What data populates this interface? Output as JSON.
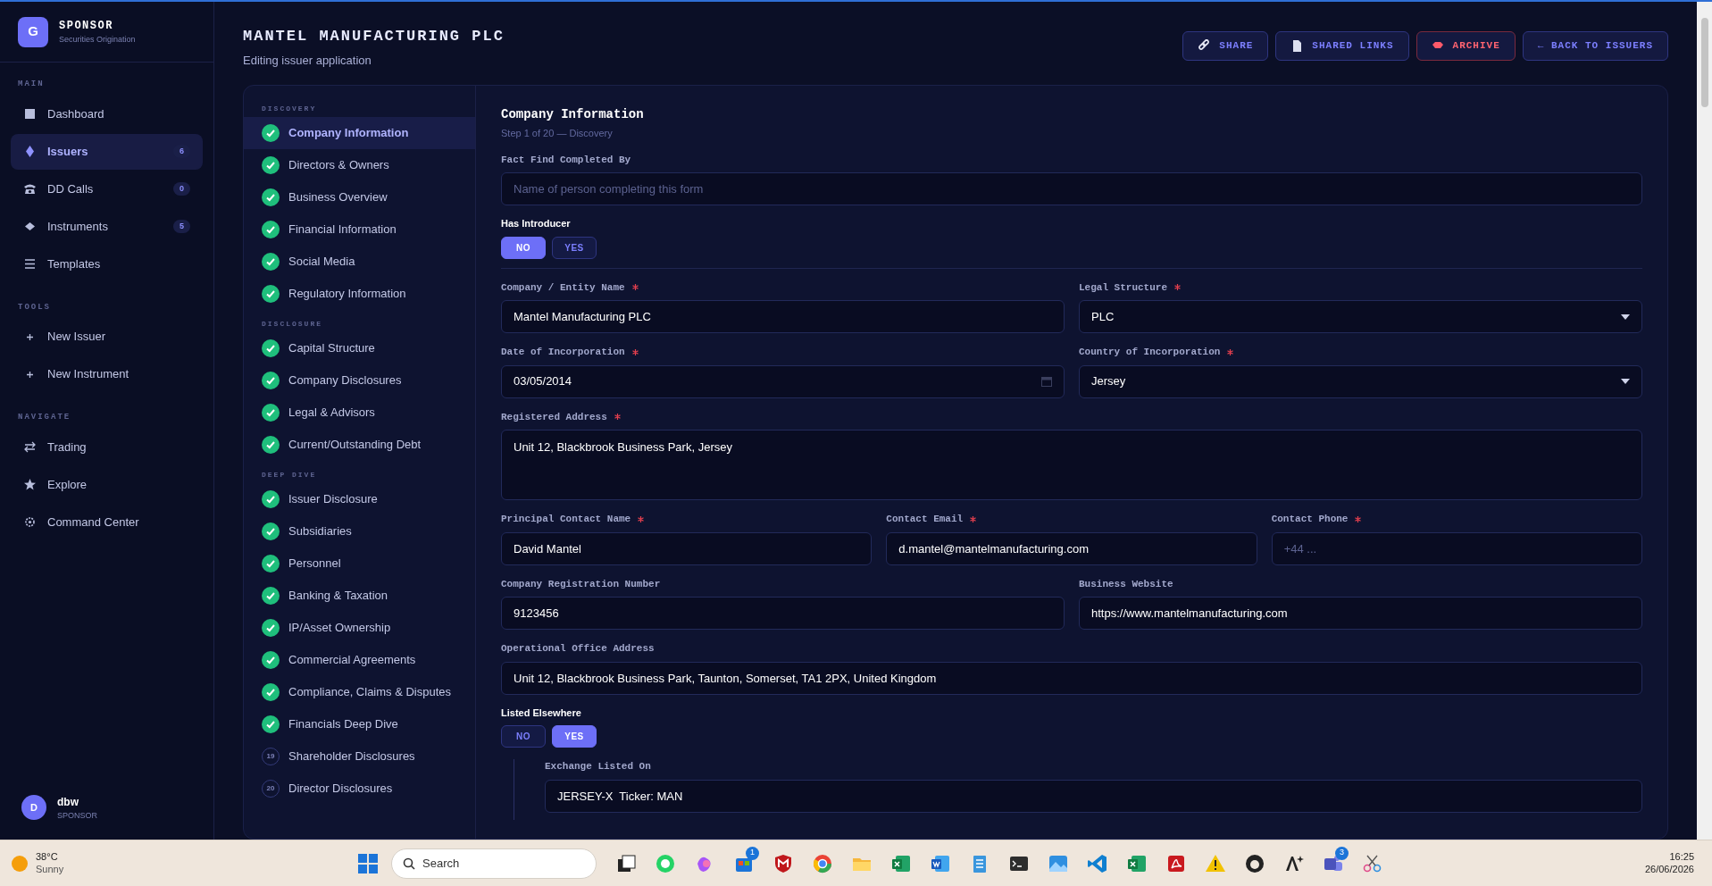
{
  "brand": {
    "logo_letter": "G",
    "title": "SPONSOR",
    "subtitle": "Securities Origination"
  },
  "sidebar": {
    "sections": [
      {
        "title": "MAIN",
        "items": [
          {
            "label": "Dashboard",
            "selected": false
          },
          {
            "label": "Issuers",
            "count": "6",
            "selected": true
          },
          {
            "label": "DD Calls",
            "count": "0",
            "selected": false
          },
          {
            "label": "Instruments",
            "count": "5",
            "selected": false
          },
          {
            "label": "Templates",
            "selected": false
          }
        ]
      },
      {
        "title": "TOOLS",
        "items": [
          {
            "label": "New Issuer",
            "selected": false
          },
          {
            "label": "New Instrument",
            "selected": false
          }
        ]
      },
      {
        "title": "NAVIGATE",
        "items": [
          {
            "label": "Trading",
            "selected": false
          },
          {
            "label": "Explore",
            "selected": false
          },
          {
            "label": "Command Center",
            "selected": false
          }
        ]
      }
    ]
  },
  "user": {
    "initial": "D",
    "name": "dbw",
    "role": "SPONSOR"
  },
  "header": {
    "title": "MANTEL MANUFACTURING PLC",
    "subtitle": "Editing issuer application"
  },
  "actions": [
    {
      "label": "SHARE",
      "kind": "link"
    },
    {
      "label": "SHARED LINKS",
      "kind": "doc"
    },
    {
      "label": "ARCHIVE",
      "kind": "danger"
    },
    {
      "label": "← BACK TO ISSUERS",
      "kind": "plain"
    }
  ],
  "steps": [
    {
      "group": "DISCOVERY",
      "items": [
        {
          "label": "Company Information",
          "done": true,
          "selected": true
        },
        {
          "label": "Directors & Owners",
          "done": true,
          "selected": false
        },
        {
          "label": "Business Overview",
          "done": true,
          "selected": false
        },
        {
          "label": "Financial Information",
          "done": true,
          "selected": false
        },
        {
          "label": "Social Media",
          "done": true,
          "selected": false
        },
        {
          "label": "Regulatory Information",
          "done": true,
          "selected": false
        }
      ]
    },
    {
      "group": "DISCLOSURE",
      "items": [
        {
          "label": "Capital Structure",
          "done": true,
          "selected": false
        },
        {
          "label": "Company Disclosures",
          "done": true,
          "selected": false
        },
        {
          "label": "Legal & Advisors",
          "done": true,
          "selected": false
        },
        {
          "label": "Current/Outstanding Debt",
          "done": true,
          "selected": false
        }
      ]
    },
    {
      "group": "DEEP DIVE",
      "items": [
        {
          "label": "Issuer Disclosure",
          "done": true,
          "selected": false
        },
        {
          "label": "Subsidiaries",
          "done": true,
          "selected": false
        },
        {
          "label": "Personnel",
          "done": true,
          "selected": false
        },
        {
          "label": "Banking & Taxation",
          "done": true,
          "selected": false
        },
        {
          "label": "IP/Asset Ownership",
          "done": true,
          "selected": false
        },
        {
          "label": "Commercial Agreements",
          "done": true,
          "selected": false
        },
        {
          "label": "Compliance, Claims & Disputes",
          "done": true,
          "selected": false
        },
        {
          "label": "Financials Deep Dive",
          "done": true,
          "selected": false
        },
        {
          "label": "Shareholder Disclosures",
          "done": false,
          "number": "19",
          "selected": false
        },
        {
          "label": "Director Disclosures",
          "done": false,
          "number": "20",
          "selected": false
        }
      ]
    }
  ],
  "form": {
    "title": "Company Information",
    "subtitle": "Step 1 of 20 — Discovery",
    "blocks": [
      {
        "kind": "fields",
        "fields": [
          {
            "label": "Fact Find Completed By",
            "required": false,
            "kind": "text",
            "placeholder": "Name of person completing this form"
          }
        ]
      },
      {
        "kind": "toggle",
        "label": "Has Introducer",
        "options": [
          {
            "label": "NO",
            "selected": true
          },
          {
            "label": "YES",
            "selected": false
          }
        ]
      },
      {
        "kind": "divider"
      },
      {
        "kind": "fields",
        "fields": [
          {
            "label": "Company / Entity Name",
            "required": true,
            "kind": "text",
            "value": "Mantel Manufacturing PLC"
          },
          {
            "label": "Legal Structure",
            "required": true,
            "kind": "select",
            "value": "PLC"
          }
        ]
      },
      {
        "kind": "fields",
        "fields": [
          {
            "label": "Date of Incorporation",
            "required": true,
            "kind": "date",
            "value": "03/05/2014"
          },
          {
            "label": "Country of Incorporation",
            "required": true,
            "kind": "select",
            "value": "Jersey"
          }
        ]
      },
      {
        "kind": "fields",
        "fields": [
          {
            "label": "Registered Address",
            "required": true,
            "kind": "textarea",
            "value": "Unit 12, Blackbrook Business Park, Jersey"
          }
        ]
      },
      {
        "kind": "fields",
        "fields": [
          {
            "label": "Principal Contact Name",
            "required": true,
            "kind": "text",
            "value": "David Mantel"
          },
          {
            "label": "Contact Email",
            "required": true,
            "kind": "text",
            "value": "d.mantel@mantelmanufacturing.com"
          },
          {
            "label": "Contact Phone",
            "required": true,
            "kind": "text",
            "placeholder": "+44 ..."
          }
        ]
      },
      {
        "kind": "fields",
        "fields": [
          {
            "label": "Company Registration Number",
            "required": false,
            "kind": "text",
            "value": "9123456"
          },
          {
            "label": "Business Website",
            "required": false,
            "kind": "text",
            "value": "https://www.mantelmanufacturing.com"
          }
        ]
      },
      {
        "kind": "fields",
        "fields": [
          {
            "label": "Operational Office Address",
            "required": false,
            "kind": "text",
            "value": "Unit 12, Blackbrook Business Park, Taunton, Somerset, TA1 2PX, United Kingdom"
          }
        ]
      },
      {
        "kind": "toggle",
        "label": "Listed Elsewhere",
        "options": [
          {
            "label": "NO",
            "selected": false
          },
          {
            "label": "YES",
            "selected": true
          }
        ]
      },
      {
        "kind": "nested",
        "fields": [
          {
            "label": "Exchange Listed On",
            "required": false,
            "kind": "text",
            "value": "JERSEY-X  Ticker: MAN"
          }
        ]
      }
    ]
  },
  "taskbar": {
    "weather": {
      "temp": "38°C",
      "condition": "Sunny"
    },
    "search_placeholder": "Search",
    "apps": [
      {
        "kind": "taskview"
      },
      {
        "kind": "chat"
      },
      {
        "kind": "copilot"
      },
      {
        "kind": "store",
        "badge": "1"
      },
      {
        "kind": "shield"
      },
      {
        "kind": "browser"
      },
      {
        "kind": "folder"
      },
      {
        "kind": "sheet"
      },
      {
        "kind": "word"
      },
      {
        "kind": "notes"
      },
      {
        "kind": "terminal"
      },
      {
        "kind": "photos"
      },
      {
        "kind": "code"
      },
      {
        "kind": "sheet"
      },
      {
        "kind": "pdf"
      },
      {
        "kind": "warning"
      },
      {
        "kind": "github"
      },
      {
        "kind": "ai"
      },
      {
        "kind": "teams",
        "badge": "3"
      },
      {
        "kind": "snip"
      }
    ],
    "time": "16:25",
    "date": "26/06/2026"
  }
}
